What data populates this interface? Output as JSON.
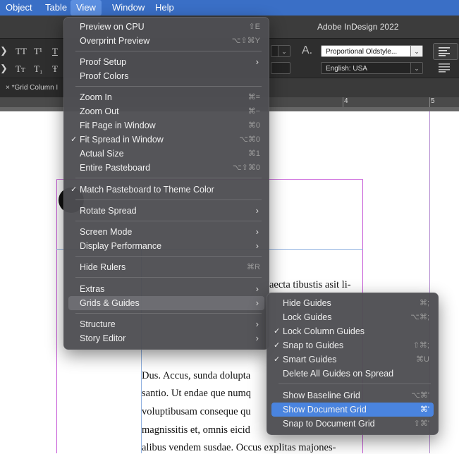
{
  "menubar": {
    "items": [
      {
        "label": "Object"
      },
      {
        "label": "Table"
      },
      {
        "label": "View"
      },
      {
        "label": "Window"
      },
      {
        "label": "Help"
      }
    ],
    "active": "View"
  },
  "app": {
    "title": "Adobe InDesign 2022"
  },
  "control_panel": {
    "char_buttons_row1": [
      "TT",
      "T¹",
      "T"
    ],
    "char_buttons_row2": [
      "Tт",
      "T₁",
      "Ŧ"
    ],
    "figure_style": "Proportional Oldstyle...",
    "language": "English: USA",
    "type_icon": "A."
  },
  "document": {
    "tab_label": "×  *Grid Column I"
  },
  "ruler": {
    "labels": [
      "4",
      "5"
    ]
  },
  "view_menu": [
    {
      "label": "Preview on CPU",
      "shortcut": "⇧E"
    },
    {
      "label": "Overprint Preview",
      "shortcut": "⌥⇧⌘Y"
    },
    {
      "label": "Proof Setup",
      "submenu": true
    },
    {
      "label": "Proof Colors"
    },
    {
      "label": "Zoom In",
      "shortcut": "⌘="
    },
    {
      "label": "Zoom Out",
      "shortcut": "⌘−"
    },
    {
      "label": "Fit Page in Window",
      "shortcut": "⌘0"
    },
    {
      "label": "Fit Spread in Window",
      "shortcut": "⌥⌘0",
      "checked": true
    },
    {
      "label": "Actual Size",
      "shortcut": "⌘1"
    },
    {
      "label": "Entire Pasteboard",
      "shortcut": "⌥⇧⌘0"
    },
    {
      "label": "Match Pasteboard to Theme Color",
      "checked": true
    },
    {
      "label": "Rotate Spread",
      "submenu": true
    },
    {
      "label": "Screen Mode",
      "submenu": true
    },
    {
      "label": "Display Performance",
      "submenu": true
    },
    {
      "label": "Hide Rulers",
      "shortcut": "⌘R"
    },
    {
      "label": "Extras",
      "submenu": true
    },
    {
      "label": "Grids & Guides",
      "submenu": true,
      "highlighted": true
    },
    {
      "label": "Structure",
      "submenu": true
    },
    {
      "label": "Story Editor",
      "submenu": true
    }
  ],
  "guides_submenu": [
    {
      "label": "Hide Guides",
      "shortcut": "⌘;"
    },
    {
      "label": "Lock Guides",
      "shortcut": "⌥⌘;"
    },
    {
      "label": "Lock Column Guides",
      "checked": true
    },
    {
      "label": "Snap to Guides",
      "shortcut": "⇧⌘;",
      "checked": true
    },
    {
      "label": "Smart Guides",
      "shortcut": "⌘U",
      "checked": true
    },
    {
      "label": "Delete All Guides on Spread"
    },
    {
      "label": "Show Baseline Grid",
      "shortcut": "⌥⌘'"
    },
    {
      "label": "Show Document Grid",
      "shortcut": "⌘'",
      "highlighted": true
    },
    {
      "label": "Snap to Document Grid",
      "shortcut": "⇧⌘'"
    }
  ],
  "body_text": {
    "line0": "aecta tibustis asit li-",
    "line1": "Dus. Accus, sunda dolupta",
    "line2": "santio. Ut endae que numq",
    "line3": "voluptibusam conseque qu",
    "line4": "magnissitis et, omnis eicid",
    "line5": "alibus vendem susdae. Occus explitas majones-"
  },
  "colors": {
    "menubar": "#3a6fc6",
    "menu_highlight": "#4a84df",
    "margin_guide": "#c65ad6",
    "column_guide": "#8fb0e0"
  }
}
